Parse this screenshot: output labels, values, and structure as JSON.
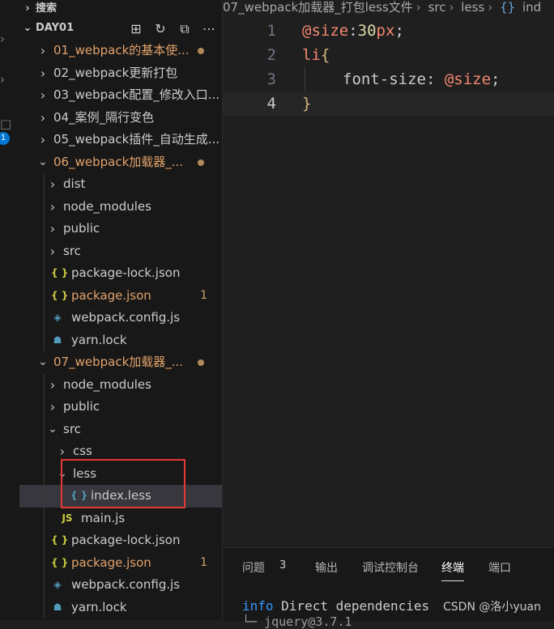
{
  "sidebar": {
    "search_label": "搜索",
    "root_label": "DAY01",
    "items": [
      {
        "label": "01_webpack的基本使...",
        "indent": 0,
        "kind": "folder",
        "open": false,
        "dot": true,
        "modified": true
      },
      {
        "label": "02_webpack更新打包",
        "indent": 0,
        "kind": "folder",
        "open": false
      },
      {
        "label": "03_webpack配置_修改入口...",
        "indent": 0,
        "kind": "folder",
        "open": false
      },
      {
        "label": "04_案例_隔行变色",
        "indent": 0,
        "kind": "folder",
        "open": false
      },
      {
        "label": "05_webpack插件_自动生成...",
        "indent": 0,
        "kind": "folder",
        "open": false
      },
      {
        "label": "06_webpack加载器_...",
        "indent": 0,
        "kind": "folder",
        "open": true,
        "dot": true,
        "modified": true
      },
      {
        "label": "dist",
        "indent": 1,
        "kind": "folder",
        "open": false
      },
      {
        "label": "node_modules",
        "indent": 1,
        "kind": "folder",
        "open": false
      },
      {
        "label": "public",
        "indent": 1,
        "kind": "folder",
        "open": false
      },
      {
        "label": "src",
        "indent": 1,
        "kind": "folder",
        "open": false
      },
      {
        "label": "package-lock.json",
        "indent": 1,
        "kind": "json"
      },
      {
        "label": "package.json",
        "indent": 1,
        "kind": "json",
        "modified": true,
        "badge": "1"
      },
      {
        "label": "webpack.config.js",
        "indent": 1,
        "kind": "webpack"
      },
      {
        "label": "yarn.lock",
        "indent": 1,
        "kind": "yarn"
      },
      {
        "label": "07_webpack加载器_...",
        "indent": 0,
        "kind": "folder",
        "open": true,
        "dot": true,
        "modified": true
      },
      {
        "label": "node_modules",
        "indent": 1,
        "kind": "folder",
        "open": false
      },
      {
        "label": "public",
        "indent": 1,
        "kind": "folder",
        "open": false
      },
      {
        "label": "src",
        "indent": 1,
        "kind": "folder",
        "open": true
      },
      {
        "label": "css",
        "indent": 2,
        "kind": "folder",
        "open": false
      },
      {
        "label": "less",
        "indent": 2,
        "kind": "folder",
        "open": true
      },
      {
        "label": "index.less",
        "indent": 3,
        "kind": "less",
        "selected": true
      },
      {
        "label": "main.js",
        "indent": 2,
        "kind": "js"
      },
      {
        "label": "package-lock.json",
        "indent": 1,
        "kind": "json"
      },
      {
        "label": "package.json",
        "indent": 1,
        "kind": "json",
        "modified": true,
        "badge": "1"
      },
      {
        "label": "webpack.config.js",
        "indent": 1,
        "kind": "webpack"
      },
      {
        "label": "yarn.lock",
        "indent": 1,
        "kind": "yarn"
      }
    ]
  },
  "breadcrumb": {
    "folder": "07_webpack加载器_打包less文件",
    "src": "src",
    "less": "less",
    "file": "ind"
  },
  "editor": {
    "lines": [
      "1",
      "2",
      "3",
      "4"
    ],
    "line1": {
      "var": "@size",
      "colon": ":",
      "num": "30",
      "unit": "px",
      "semi": ";"
    },
    "line2": {
      "tag": "li",
      "brace": "{"
    },
    "line3": {
      "prop": "font-size",
      "colon": ": ",
      "var": "@size",
      "semi": ";"
    },
    "line4": {
      "brace": "}"
    }
  },
  "panel": {
    "tabs": [
      "问题",
      "输出",
      "调试控制台",
      "终端",
      "端口"
    ],
    "problems_count": "3",
    "active_tab": "终端",
    "terminal_info": "info",
    "terminal_text": " Direct dependencies",
    "terminal_line2": "└─ jquery@3.7.1",
    "watermark": "CSDN @洛小yuan"
  },
  "activity": {
    "badge": "1"
  },
  "colors": {
    "accent": "#0078d4",
    "highlight_box": "#e53935",
    "modified": "#e2a26b",
    "less_variable": "#f48771"
  }
}
